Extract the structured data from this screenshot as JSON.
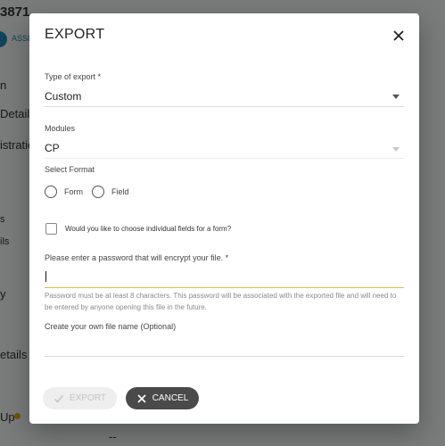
{
  "background": {
    "title_fragment": "3871",
    "subtitle_fragment": "ASSI",
    "side_items": [
      "n",
      "Details",
      "istration",
      "s",
      "ils",
      "y",
      "etails",
      "Up"
    ],
    "bottom_fragment": "--"
  },
  "dialog": {
    "title": "EXPORT",
    "type_of_export": {
      "label": "Type of export *",
      "value": "Custom"
    },
    "modules": {
      "label": "Modules",
      "value": "CP"
    },
    "select_format": {
      "label": "Select Format",
      "options": [
        "Form",
        "Field"
      ]
    },
    "individual_fields": {
      "label": "Would you like to choose individual fields for a form?"
    },
    "password": {
      "label": "Please enter a password that will encrypt your file. *",
      "value": "",
      "help": "Password must be at least 8 characters. This password will be associated with the exported file and will need to be entered by anyone opening this file in the future."
    },
    "file_name": {
      "label": "Create your own file name (Optional)",
      "value": ""
    },
    "buttons": {
      "export": "EXPORT",
      "cancel": "CANCEL"
    }
  },
  "colors": {
    "focus_underline": "#e6b74a",
    "cancel_bg": "#4a4a4a",
    "badge": "#1e88b5",
    "status_dot": "#e0a526"
  }
}
